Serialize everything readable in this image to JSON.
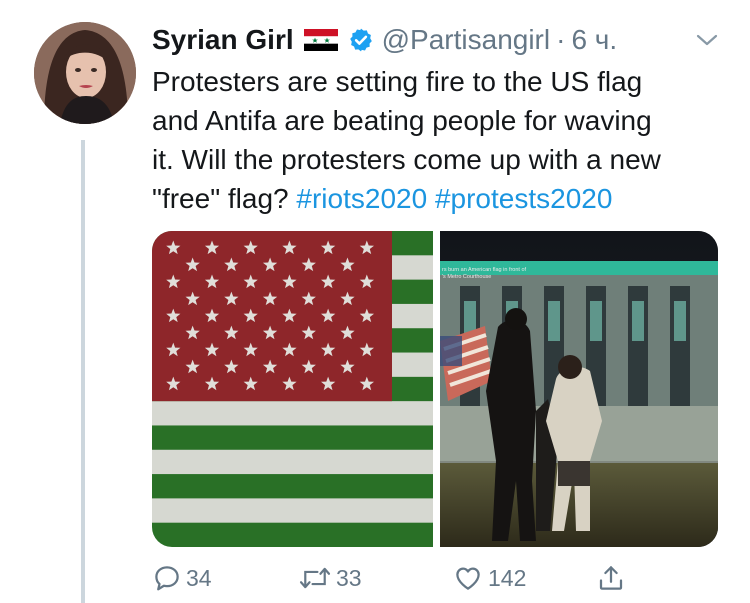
{
  "tweet": {
    "display_name": "Syrian Girl",
    "handle": "@Partisangirl",
    "separator": "·",
    "time": "6 ч.",
    "text_lines": [
      "Protesters are setting fire to the US flag",
      "and Antifa are beating people for waving",
      "it. Will the protesters come up with a new"
    ],
    "last_line_prefix": "\"free\" flag? ",
    "hashtags": [
      "#riots2020",
      "#protests2020"
    ],
    "media_caption": "rs burn an American flag in front of\n's Metro Courthouse"
  },
  "actions": {
    "reply_count": "34",
    "retweet_count": "33",
    "like_count": "142"
  },
  "icons": {
    "country_flag": "syria-flag-icon",
    "verified": "verified-badge-icon",
    "menu": "chevron-down-icon",
    "reply": "reply-icon",
    "retweet": "retweet-icon",
    "like": "heart-icon",
    "share": "share-icon"
  },
  "colors": {
    "link": "#1b95e0",
    "muted": "#657786",
    "verified": "#1da1f2",
    "thread_line": "#ccd6dd"
  }
}
